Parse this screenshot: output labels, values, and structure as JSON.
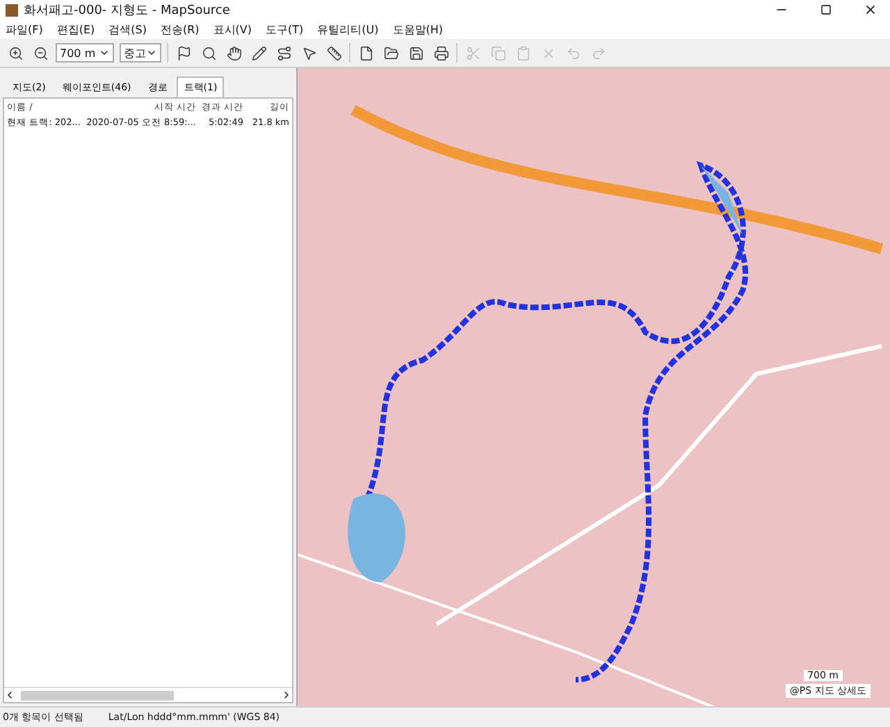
{
  "window": {
    "title": "화서패고-000- 지형도 - MapSource"
  },
  "menu": [
    "파일(F)",
    "편집(E)",
    "검색(S)",
    "전송(R)",
    "표시(V)",
    "도구(T)",
    "유틸리티(U)",
    "도움말(H)"
  ],
  "toolbar": {
    "zoom_scale": "700 m",
    "detail": "중고"
  },
  "tabs": [
    {
      "label": "지도(2)",
      "selected": false
    },
    {
      "label": "웨이포인트(46)",
      "selected": false
    },
    {
      "label": "경로",
      "selected": false
    },
    {
      "label": "트랙(1)",
      "selected": true
    }
  ],
  "table": {
    "columns": [
      "이름 /",
      "시작 시간",
      "경과 시간",
      "길이"
    ],
    "rows": [
      [
        "현재 트랙: 202...",
        "2020-07-05 오전 8:59:...",
        "5:02:49",
        "21.8 km"
      ]
    ]
  },
  "map": {
    "scale": "700 m",
    "credit": "@PS 지도 상세도"
  },
  "status_bar": [
    "0개 항목이 선택됨",
    "Lat/Lon hddd°mm.mmm' (WGS 84)"
  ]
}
